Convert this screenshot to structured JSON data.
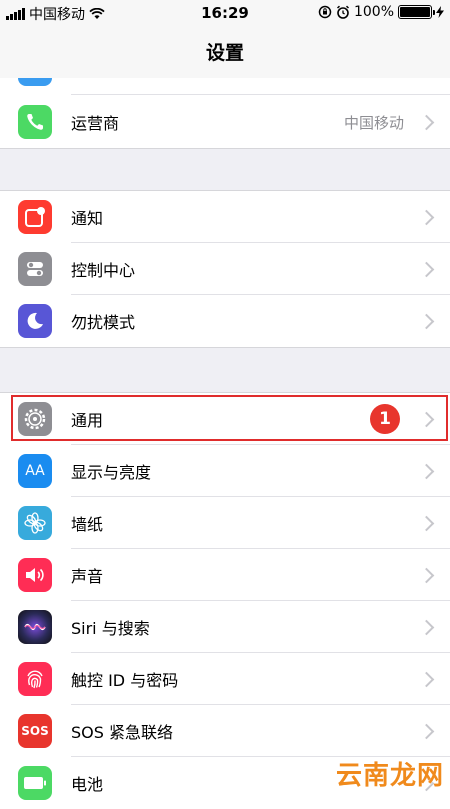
{
  "status_bar": {
    "carrier": "中国移动",
    "time": "16:29",
    "battery_text": "100%"
  },
  "nav": {
    "title": "设置"
  },
  "rows": {
    "carrier": {
      "label": "运营商",
      "detail": "中国移动"
    },
    "notifications": {
      "label": "通知"
    },
    "control_center": {
      "label": "控制中心"
    },
    "do_not_disturb": {
      "label": "勿扰模式"
    },
    "general": {
      "label": "通用",
      "badge": "1"
    },
    "display": {
      "label": "显示与亮度",
      "icon_text": "AA"
    },
    "wallpaper": {
      "label": "墙纸"
    },
    "sounds": {
      "label": "声音"
    },
    "siri": {
      "label": "Siri 与搜索"
    },
    "touch_id": {
      "label": "触控 ID 与密码"
    },
    "sos": {
      "label": "SOS 紧急联络",
      "icon_text": "SOS"
    },
    "battery": {
      "label": "电池"
    }
  },
  "colors": {
    "phone": "#4cd964",
    "notifications": "#fe3b30",
    "control_center": "#8e8e93",
    "do_not_disturb": "#5856d6",
    "general": "#8e8e93",
    "display": "#1a8cf0",
    "wallpaper": "#37aadc",
    "sounds": "#ff2d55",
    "siri": "#222244",
    "touch_id": "#ff2d55",
    "sos": "#e8352d",
    "battery": "#4cd964",
    "highlight": "#e02c2c"
  },
  "watermark": "云南龙网"
}
